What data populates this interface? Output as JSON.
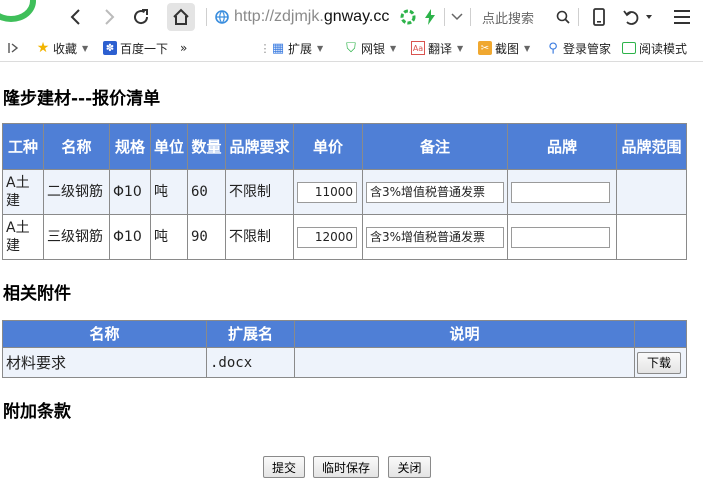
{
  "browser": {
    "url_prefix": "http://zdjmjk.",
    "url_host": "gnway.cc",
    "search_placeholder": "点此搜索",
    "bookmarks": [
      {
        "label": "收藏"
      },
      {
        "label": "百度一下"
      },
      {
        "label": "扩展"
      },
      {
        "label": "网银"
      },
      {
        "label": "翻译"
      },
      {
        "label": "截图"
      },
      {
        "label": "登录管家"
      },
      {
        "label": "阅读模式"
      }
    ],
    "overflow": "»"
  },
  "page": {
    "title": "隆步建材---报价清单",
    "quote_table": {
      "headers": [
        "工种",
        "名称",
        "规格",
        "单位",
        "数量",
        "品牌要求",
        "单价",
        "备注",
        "品牌",
        "品牌范围"
      ],
      "rows": [
        {
          "trade": "A土建",
          "name": "二级钢筋",
          "spec": "Φ10",
          "unit": "吨",
          "qty": "60",
          "brand_req": "不限制",
          "price": "11000",
          "remark": "含3%增值税普通发票",
          "brand": "",
          "brand_range": ""
        },
        {
          "trade": "A土建",
          "name": "三级钢筋",
          "spec": "Φ10",
          "unit": "吨",
          "qty": "90",
          "brand_req": "不限制",
          "price": "12000",
          "remark": "含3%增值税普通发票",
          "brand": "",
          "brand_range": ""
        }
      ]
    },
    "attachments_title": "相关附件",
    "attachments_table": {
      "headers": [
        "名称",
        "扩展名",
        "说明",
        ""
      ],
      "rows": [
        {
          "name": "材料要求",
          "ext": ".docx",
          "desc": "",
          "action": "下载"
        }
      ]
    },
    "extra_terms_title": "附加条款",
    "buttons": {
      "submit": "提交",
      "save_draft": "临时保存",
      "close": "关闭"
    }
  }
}
